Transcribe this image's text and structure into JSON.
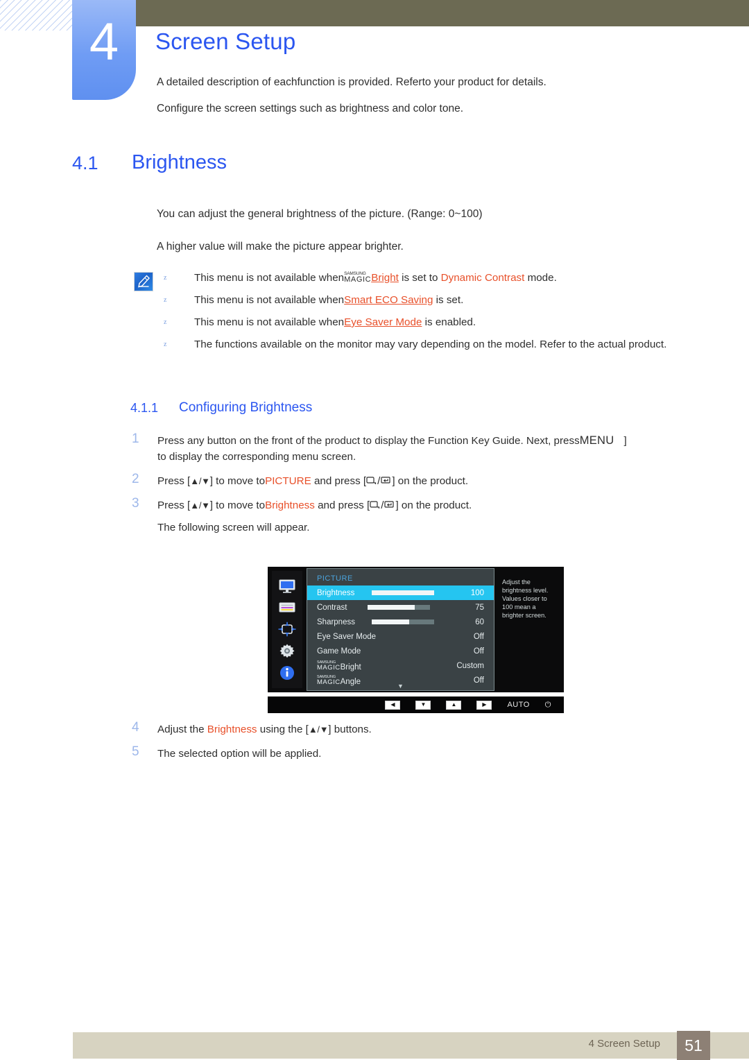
{
  "chapter": {
    "number": "4",
    "title": "Screen Setup",
    "desc_line1": "A detailed description of eachfunction is provided. Referto your product for details.",
    "desc_line2": "Configure the screen settings such as brightness and color tone."
  },
  "section": {
    "number": "4.1",
    "title": "Brightness",
    "paragraph1": "You can adjust the general brightness of the picture. (Range: 0~100)",
    "paragraph2": "A higher value will make the picture appear brighter."
  },
  "notes": {
    "bullet_glyph": "z",
    "items": [
      {
        "pre": "This menu is not available when",
        "magic_top": "SAMSUNG",
        "magic_bottom": "MAGIC",
        "term1": "Bright",
        "mid": " is set to ",
        "term2": "Dynamic Contrast",
        "post": " mode."
      },
      {
        "pre": "This menu is not available when",
        "term1": "Smart ECO Saving",
        "post": " is set."
      },
      {
        "pre": "This menu is not available when",
        "term1": "Eye Saver Mode",
        "post": " is enabled."
      },
      {
        "pre": "The functions available on the monitor may vary depending on the model. Refer to the actual product."
      }
    ]
  },
  "subsection": {
    "number": "4.1.1",
    "title": "Configuring Brightness"
  },
  "steps": [
    {
      "num": "1",
      "text_a": "Press any button on the front of the product to display the Function Key Guide. Next, press",
      "keycap": "MENU",
      "bracket": "]",
      "text_b": "to display the corresponding menu screen."
    },
    {
      "num": "2",
      "text_a": "Press [",
      "updown": "▲/▼",
      "text_b": "] to move to",
      "term": "PICTURE",
      "text_c": " and press [",
      "text_d": "] on the product."
    },
    {
      "num": "3",
      "text_a": "Press [",
      "updown": "▲/▼",
      "text_b": "] to move to",
      "term": "Brightness",
      "text_c": " and press [",
      "text_d": "] on the product.",
      "follow": "The following screen will appear."
    },
    {
      "num": "4",
      "text_a": "Adjust the ",
      "term": "Brightness",
      "text_b": " using the [",
      "updown": "▲/▼",
      "text_c": "] buttons."
    },
    {
      "num": "5",
      "text_a": "The selected option will be applied."
    }
  ],
  "osd": {
    "category": "PICTURE",
    "rail_icons": [
      "monitor-icon",
      "color-settings-icon",
      "resize-arrows-icon",
      "gear-icon",
      "info-icon"
    ],
    "rows": [
      {
        "label": "Brightness",
        "value": "100",
        "bar": 100,
        "selected": true
      },
      {
        "label": "Contrast",
        "value": "75",
        "bar": 75,
        "selected": false
      },
      {
        "label": "Sharpness",
        "value": "60",
        "bar": 60,
        "selected": false
      },
      {
        "label": "Eye Saver Mode",
        "value": "Off",
        "bar": null,
        "selected": false
      },
      {
        "label": "Game Mode",
        "value": "Off",
        "bar": null,
        "selected": false
      }
    ],
    "magic_rows": [
      {
        "top": "SAMSUNG",
        "bottom": "MAGIC",
        "suffix": "Bright",
        "value": "Custom"
      },
      {
        "top": "SAMSUNG",
        "bottom": "MAGIC",
        "suffix": "Angle",
        "value": "Off"
      }
    ],
    "scroll_glyph": "▼",
    "help_text": "Adjust the brightness level. Values closer to 100 mean a brighter screen.",
    "buttons": [
      {
        "name": "left-button",
        "glyph": "◀"
      },
      {
        "name": "down-button",
        "glyph": "▼"
      },
      {
        "name": "up-button",
        "glyph": "▲"
      },
      {
        "name": "right-button",
        "glyph": "▶"
      }
    ],
    "auto_label": "AUTO",
    "power_glyph": "⏻"
  },
  "footer": {
    "label": "4 Screen Setup",
    "page": "51"
  },
  "colors": {
    "accent_blue": "#2b56f0",
    "term_orange": "#e8502a",
    "olive": "#6c6a53",
    "footer_beige": "#d7d3c1",
    "footer_page": "#8d8075",
    "osd_highlight": "#25c5f0"
  }
}
